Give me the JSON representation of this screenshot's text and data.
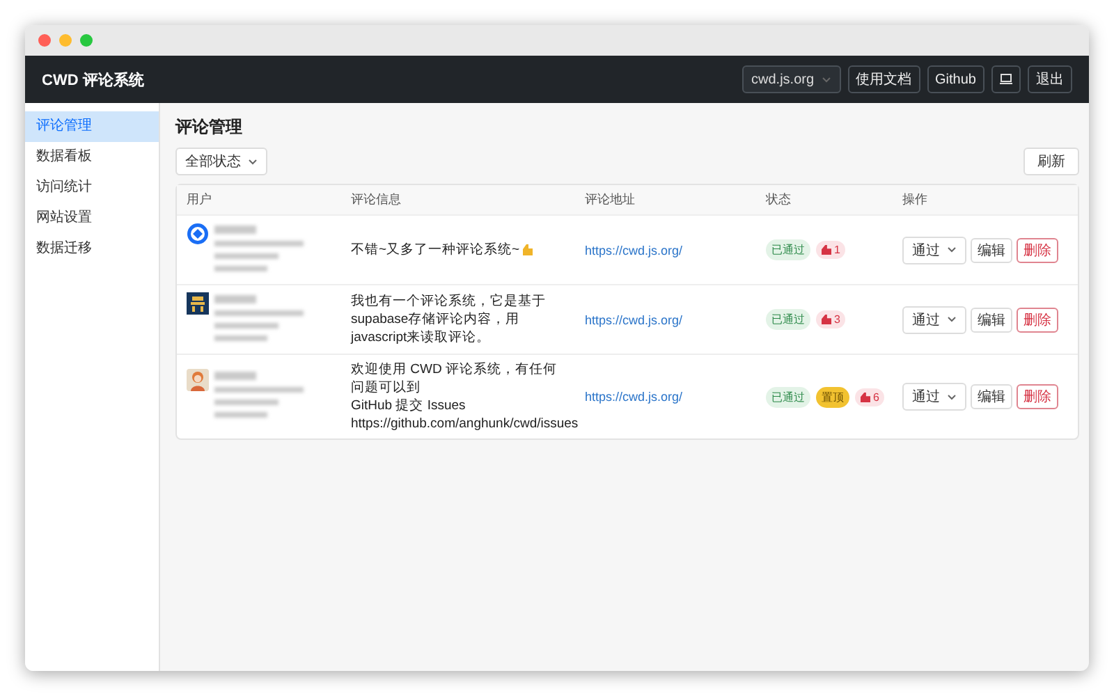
{
  "navbar": {
    "title": "CWD 评论系统",
    "site_select": {
      "value": "cwd.js.org"
    },
    "links": [
      "使用文档",
      "Github"
    ],
    "logout": "退出"
  },
  "sidebar": {
    "items": [
      {
        "label": "评论管理",
        "selected": true
      },
      {
        "label": "数据看板",
        "selected": false
      },
      {
        "label": "访问统计",
        "selected": false
      },
      {
        "label": "网站设置",
        "selected": false
      },
      {
        "label": "数据迁移",
        "selected": false
      }
    ]
  },
  "page_title": "评论管理",
  "filter": {
    "value": "全部状态"
  },
  "refresh": "刷新",
  "table": {
    "columns": [
      "用户",
      "评论信息",
      "评论地址",
      "状态",
      "操作"
    ],
    "rows": [
      {
        "comment_lines": [
          "不错~又多了一种评论系统~"
        ],
        "thumb_emoji": true,
        "url": "https://cwd.js.org/",
        "tags": [
          {
            "kind": "status",
            "label": "已通过"
          },
          {
            "kind": "likes",
            "label": "1"
          }
        ],
        "action": "通过",
        "edit": "编辑",
        "delete": "删除"
      },
      {
        "comment_lines": [
          "我也有一个评论系统，它是基于supabase存储评论内容，用javascript来读取评论。"
        ],
        "thumb_emoji": false,
        "url": "https://cwd.js.org/",
        "tags": [
          {
            "kind": "status",
            "label": "已通过"
          },
          {
            "kind": "likes",
            "label": "3"
          }
        ],
        "action": "通过",
        "edit": "编辑",
        "delete": "删除"
      },
      {
        "comment_lines": [
          "欢迎使用 CWD 评论系统，有任何问题可以到",
          "GitHub 提交 Issues",
          "https://github.com/anghunk/cwd/issues"
        ],
        "thumb_emoji": false,
        "url": "https://cwd.js.org/",
        "tags": [
          {
            "kind": "status",
            "label": "已通过"
          },
          {
            "kind": "pinned",
            "label": "置顶"
          },
          {
            "kind": "likes",
            "label": "6"
          }
        ],
        "action": "通过",
        "edit": "编辑",
        "delete": "删除"
      }
    ]
  }
}
